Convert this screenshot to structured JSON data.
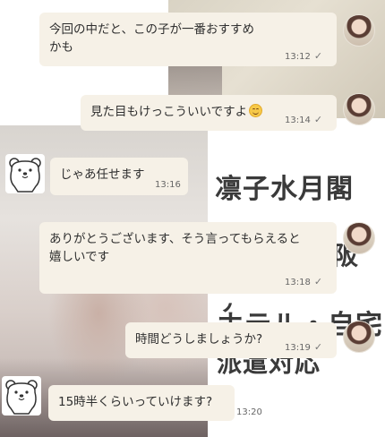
{
  "background_text": [
    "凛子水月閣",
    "阪",
    "ナ",
    "ホテル・自宅",
    "派遣対応"
  ],
  "messages": [
    {
      "side": "right",
      "text": "今回の中だと、この子が一番おすすめ\nかも",
      "time": "13:12",
      "read": "✓"
    },
    {
      "side": "right",
      "text": "見た目もけっこういいですよ",
      "emoji": "smiling-face",
      "time": "13:14",
      "read": "✓"
    },
    {
      "side": "left",
      "text": "じゃあ任せます",
      "time": "13:16"
    },
    {
      "side": "right",
      "text": "ありがとうございます、そう言ってもらえると\n嬉しいです",
      "time": "13:18",
      "read": "✓"
    },
    {
      "side": "right",
      "text": "時間どうしましょうか?",
      "time": "13:19",
      "read": "✓"
    },
    {
      "side": "left",
      "text": "15時半くらいっていけます?",
      "time": "13:20"
    }
  ]
}
